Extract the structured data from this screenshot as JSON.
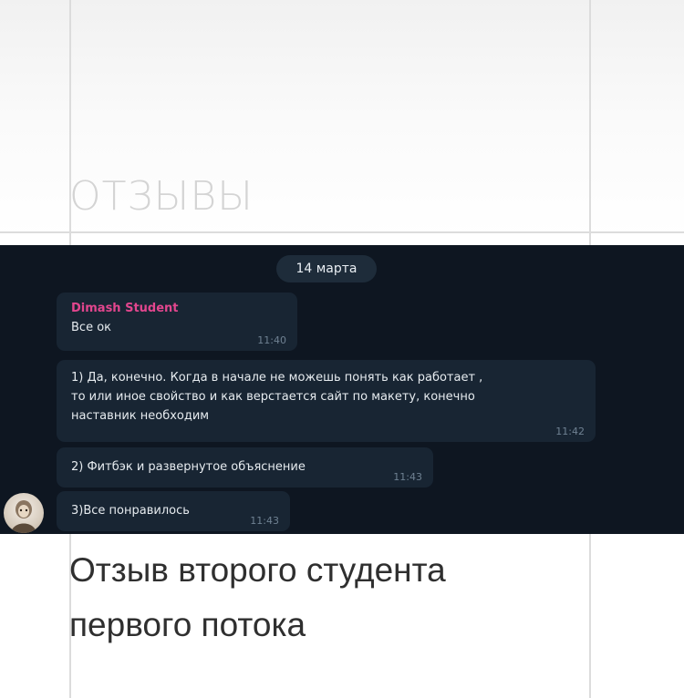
{
  "section": {
    "heading": "ОТЗЫВЫ"
  },
  "chat": {
    "date_label": "14 марта",
    "messages": [
      {
        "sender": "Dimash Student",
        "text": "Все ок",
        "time": "11:40"
      },
      {
        "lines": [
          "1) Да, конечно. Когда в начале не можешь понять как работает ,",
          "то или иное свойство и как верстается сайт по макету, конечно",
          "наставник необходим"
        ],
        "time": "11:42"
      },
      {
        "text": "2) Фитбэк и развернутое объяснение",
        "time": "11:43"
      },
      {
        "text": "3)Все понравилось",
        "time": "11:43"
      }
    ],
    "colors": {
      "background": "#0e1621",
      "bubble": "#182533",
      "sender_name": "#e2468e"
    }
  },
  "caption": {
    "line1": "Отзыв второго студента",
    "line2": "первого потока"
  }
}
